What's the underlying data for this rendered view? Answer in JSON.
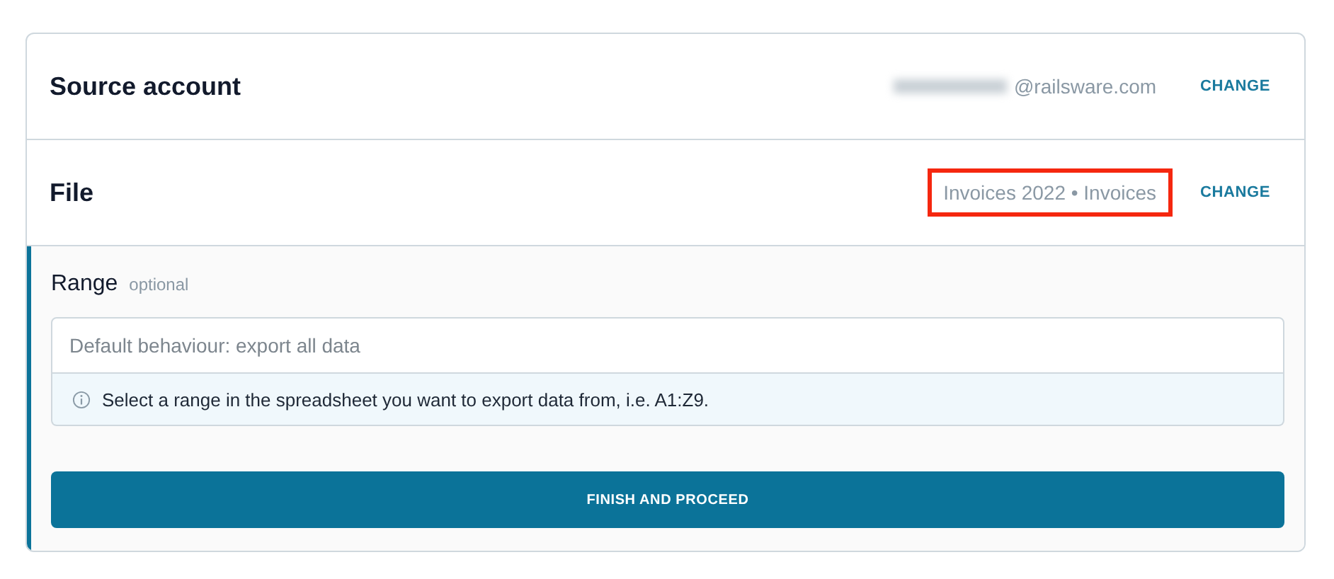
{
  "sections": [
    {
      "title": "Source account",
      "value": "@railsware.com",
      "redacted": true,
      "highlighted": false,
      "action": "CHANGE"
    },
    {
      "title": "File",
      "value": "Invoices 2022 • Invoices",
      "redacted": false,
      "highlighted": true,
      "action": "CHANGE"
    }
  ],
  "range": {
    "label": "Range",
    "hint": "optional",
    "placeholder": "Default behaviour: export all data",
    "info": "Select a range in the spreadsheet you want to export data from, i.e. A1:Z9."
  },
  "button": "FINISH AND PROCEED"
}
